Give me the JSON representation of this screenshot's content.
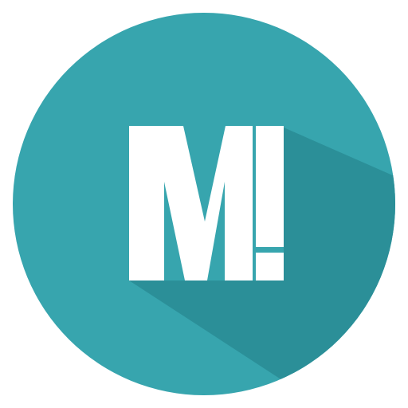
{
  "logo": {
    "monogram": "M!",
    "colors": {
      "circle": "#37a5ae",
      "shadow": "#2b8f98",
      "letter": "#ffffff",
      "background": "#ffffff"
    }
  }
}
